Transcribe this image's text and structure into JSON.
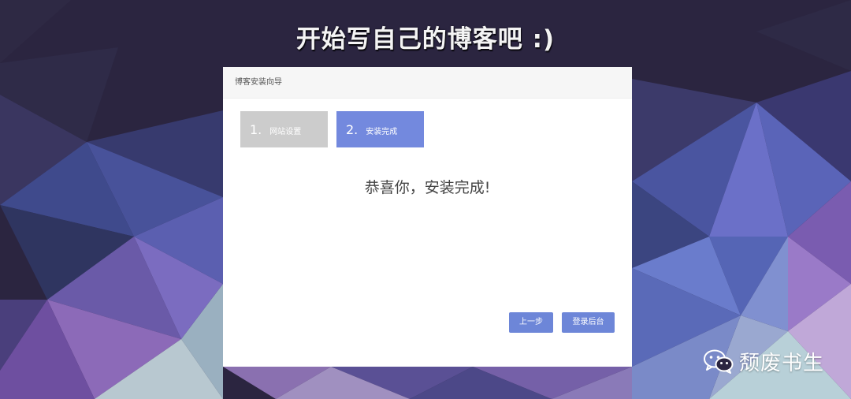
{
  "page": {
    "headline": "开始写自己的博客吧 :)"
  },
  "panel": {
    "title": "博客安装向导",
    "steps": [
      {
        "number": "1.",
        "label": "网站设置",
        "state": "inactive"
      },
      {
        "number": "2.",
        "label": "安装完成",
        "state": "active"
      }
    ],
    "message": "恭喜你，安装完成!",
    "buttons": {
      "prev": "上一步",
      "admin_login": "登录后台"
    }
  },
  "watermark": {
    "text": "颓废书生",
    "icon": "wechat-icon"
  },
  "colors": {
    "active_step": "#7389de",
    "inactive_step": "#cccccc",
    "button": "#6d86d8",
    "background": "#2b2540"
  }
}
